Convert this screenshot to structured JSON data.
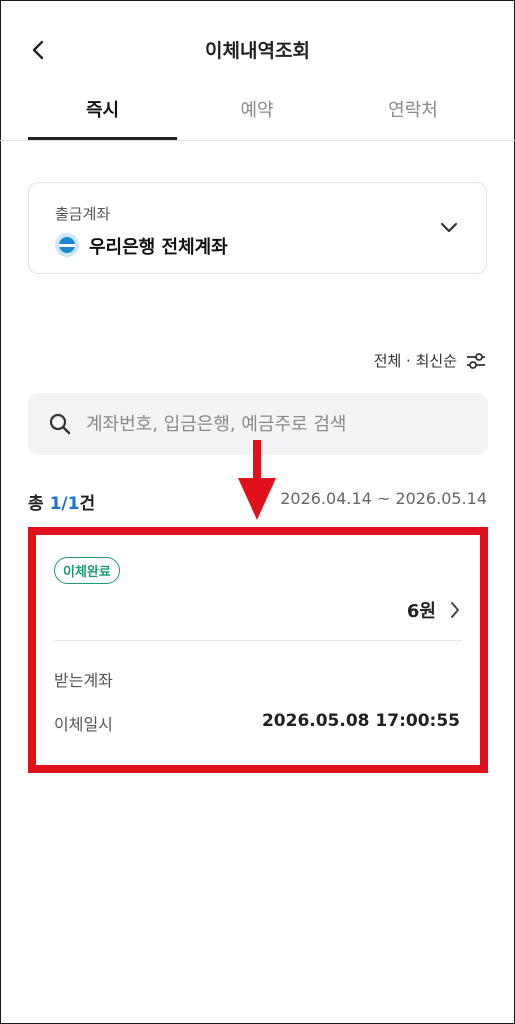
{
  "header": {
    "title": "이체내역조회"
  },
  "tabs": [
    {
      "label": "즉시",
      "active": true
    },
    {
      "label": "예약",
      "active": false
    },
    {
      "label": "연락처",
      "active": false
    }
  ],
  "account": {
    "label": "출금계좌",
    "name": "우리은행 전체계좌"
  },
  "filter": {
    "label": "전체 · 최신순"
  },
  "search": {
    "placeholder": "계좌번호, 입금은행, 예금주로 검색"
  },
  "summary": {
    "prefix": "총 ",
    "count": "1/1",
    "suffix": "건",
    "date_range": "2026.04.14 ~ 2026.05.14"
  },
  "transaction": {
    "status": "이체완료",
    "amount": "6원",
    "receiving_label": "받는계좌",
    "receiving_value": "",
    "datetime_label": "이체일시",
    "datetime_value": "2026.05.08 17:00:55"
  },
  "colors": {
    "accent": "#1a73c8",
    "status_green": "#1e9a72",
    "highlight_red": "#e1111b"
  }
}
